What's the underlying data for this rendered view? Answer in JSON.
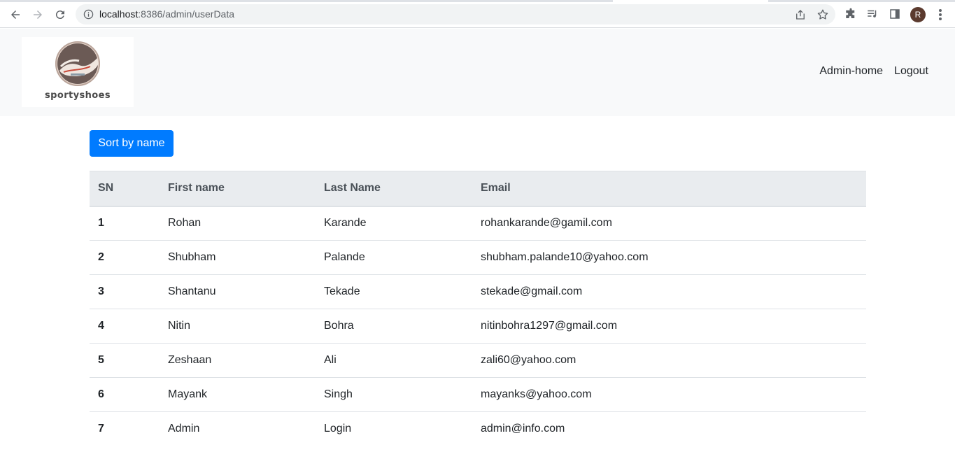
{
  "browser": {
    "url_host": "localhost",
    "url_rest": ":8386/admin/userData",
    "avatar_letter": "R"
  },
  "navbar": {
    "brand": "sportyshoes",
    "links": [
      "Admin-home",
      "Logout"
    ]
  },
  "sort_button": "Sort by name",
  "table": {
    "headers": [
      "SN",
      "First name",
      "Last Name",
      "Email"
    ],
    "rows": [
      [
        "1",
        "Rohan",
        "Karande",
        "rohankarande@gamil.com"
      ],
      [
        "2",
        "Shubham",
        "Palande",
        "shubham.palande10@yahoo.com"
      ],
      [
        "3",
        "Shantanu",
        "Tekade",
        "stekade@gmail.com"
      ],
      [
        "4",
        "Nitin",
        "Bohra",
        "nitinbohra1297@gmail.com"
      ],
      [
        "5",
        "Zeshaan",
        "Ali",
        "zali60@yahoo.com"
      ],
      [
        "6",
        "Mayank",
        "Singh",
        "mayanks@yahoo.com"
      ],
      [
        "7",
        "Admin",
        "Login",
        "admin@info.com"
      ]
    ]
  },
  "colors": {
    "primary": "#007bff",
    "navbar_bg": "#f8f9fa",
    "table_head_bg": "#e9ecef"
  }
}
